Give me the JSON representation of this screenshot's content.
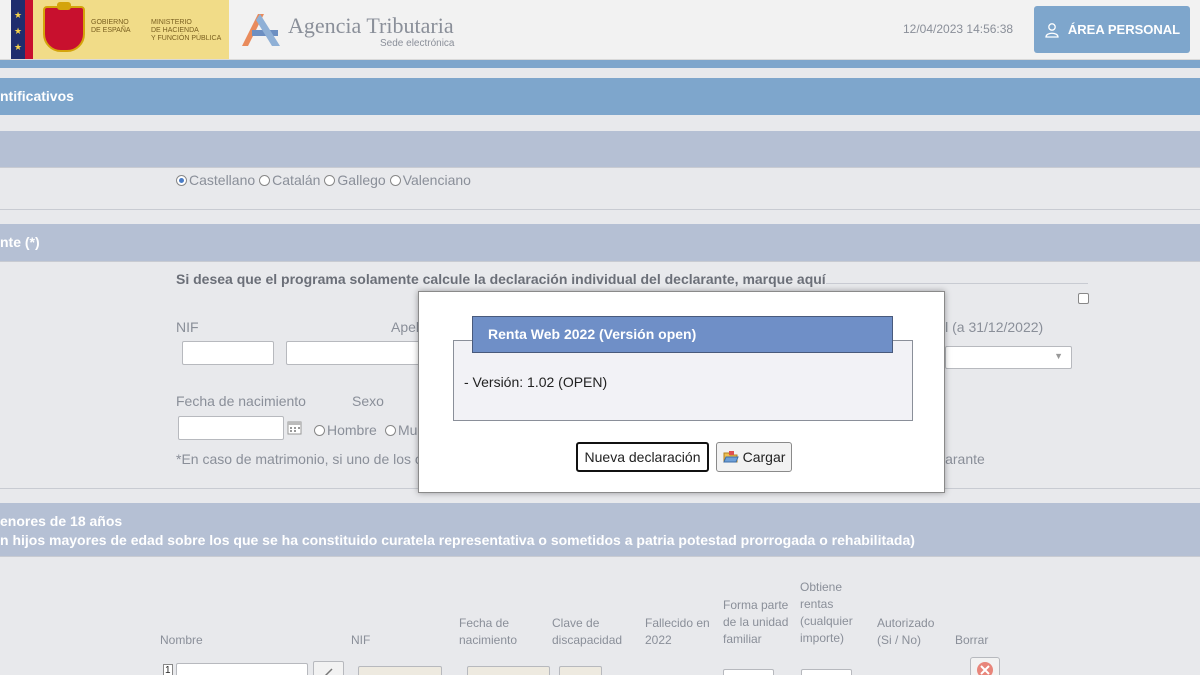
{
  "header": {
    "gov_text": "GOBIERNO\nDE ESPAÑA",
    "ministry_text": "MINISTERIO\nDE HACIENDA\nY FUNCIÓN PÚBLICA",
    "agency_title": "Agencia Tributaria",
    "agency_subtitle": "Sede electrónica",
    "timestamp": "12/04/2023 14:56:38",
    "area_personal_label": "ÁREA PERSONAL"
  },
  "sections": {
    "identificativos": "ntificativos",
    "declarante": "nte (*)",
    "hijos_line1": "enores de 18 años",
    "hijos_line2": "n hijos mayores de edad sobre los que se ha constituido curatela representativa o sometidos a patria potestad prorrogada o rehabilitada)"
  },
  "languages": [
    {
      "label": "Castellano",
      "selected": true
    },
    {
      "label": "Catalán",
      "selected": false
    },
    {
      "label": "Gallego",
      "selected": false
    },
    {
      "label": "Valenciano",
      "selected": false
    }
  ],
  "declarante": {
    "individual_text": "Si desea que el programa solamente calcule la declaración individual del declarante, marque aquí",
    "nif_label": "NIF",
    "apellidos_label": "Apel",
    "estado_civil_label": "il (a 31/12/2022)",
    "fecha_label": "Fecha de nacimiento",
    "sexo_label": "Sexo",
    "hombre_label": "Hombre",
    "mujer_label": "Mu",
    "note_text": "*En caso de matrimonio, si uno de los c",
    "note_tail": "larante"
  },
  "hijos_table": {
    "columns": [
      "Nombre",
      "NIF",
      "Fecha de\nnacimiento",
      "Clave de\ndiscapacidad",
      "Fallecido en\n2022",
      "Forma parte\nde la unidad\nfamiliar",
      "Obtiene\nrentas\n(cualquier\nimporte)",
      "Autorizado\n(Si / No)",
      "Borrar"
    ],
    "row_number": "1"
  },
  "modal": {
    "title": "Renta Web 2022 (Versión open)",
    "version": "- Versión: 1.02 (OPEN)",
    "new_button": "Nueva declaración",
    "load_button": "Cargar"
  }
}
